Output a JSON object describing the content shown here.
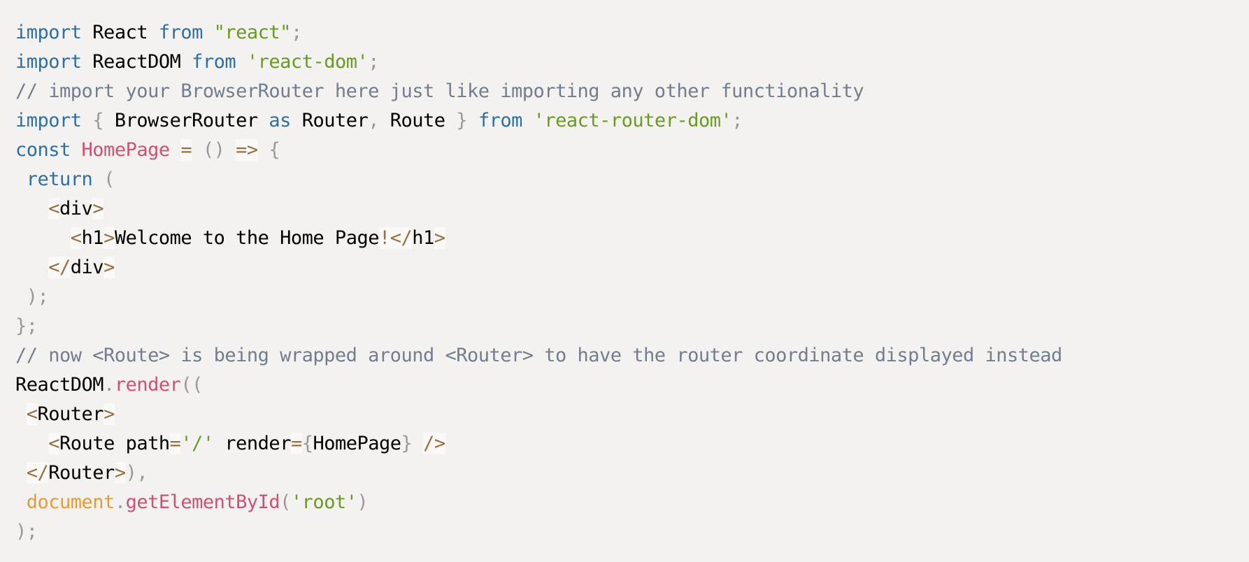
{
  "code": {
    "language": "jsx",
    "colors": {
      "background": "#f4f2f0",
      "keyword": "#2d6fa4",
      "string": "#6a9a23",
      "comment": "#727d8e",
      "function": "#d05070",
      "punctuation": "#999999",
      "operator": "#96703f",
      "object": "#e69a35",
      "plain": "#000000"
    },
    "lines": [
      [
        [
          "kw",
          "import"
        ],
        [
          "plain",
          " React "
        ],
        [
          "kw",
          "from"
        ],
        [
          "plain",
          " "
        ],
        [
          "str",
          "\"react\""
        ],
        [
          "punc",
          ";"
        ]
      ],
      [
        [
          "kw",
          "import"
        ],
        [
          "plain",
          " ReactDOM "
        ],
        [
          "kw",
          "from"
        ],
        [
          "plain",
          " "
        ],
        [
          "str",
          "'react-dom'"
        ],
        [
          "punc",
          ";"
        ]
      ],
      [
        [
          "cm",
          "// import your BrowserRouter here just like importing any other functionality"
        ]
      ],
      [
        [
          "kw",
          "import"
        ],
        [
          "plain",
          " "
        ],
        [
          "punc",
          "{"
        ],
        [
          "plain",
          " BrowserRouter "
        ],
        [
          "kw",
          "as"
        ],
        [
          "plain",
          " Router"
        ],
        [
          "punc",
          ","
        ],
        [
          "plain",
          " Route "
        ],
        [
          "punc",
          "}"
        ],
        [
          "plain",
          " "
        ],
        [
          "kw",
          "from"
        ],
        [
          "plain",
          " "
        ],
        [
          "str",
          "'react-router-dom'"
        ],
        [
          "punc",
          ";"
        ]
      ],
      [
        [
          "kw",
          "const"
        ],
        [
          "plain",
          " "
        ],
        [
          "fn",
          "HomePage"
        ],
        [
          "plain",
          " "
        ],
        [
          "op",
          "="
        ],
        [
          "plain",
          " "
        ],
        [
          "punc",
          "()"
        ],
        [
          "plain",
          " "
        ],
        [
          "op",
          "=>"
        ],
        [
          "plain",
          " "
        ],
        [
          "punc",
          "{"
        ]
      ],
      [
        [
          "plain",
          " "
        ],
        [
          "kw",
          "return"
        ],
        [
          "plain",
          " "
        ],
        [
          "punc",
          "("
        ]
      ],
      [
        [
          "plain",
          "   "
        ],
        [
          "op",
          "<"
        ],
        [
          "plain",
          "div"
        ],
        [
          "op",
          ">"
        ]
      ],
      [
        [
          "plain",
          "     "
        ],
        [
          "op",
          "<"
        ],
        [
          "plain",
          "h1"
        ],
        [
          "op",
          ">"
        ],
        [
          "plain",
          "Welcome to the Home Page"
        ],
        [
          "op",
          "!</"
        ],
        [
          "plain",
          "h1"
        ],
        [
          "op",
          ">"
        ]
      ],
      [
        [
          "plain",
          "   "
        ],
        [
          "op",
          "</"
        ],
        [
          "plain",
          "div"
        ],
        [
          "op",
          ">"
        ]
      ],
      [
        [
          "plain",
          " "
        ],
        [
          "punc",
          ");"
        ]
      ],
      [
        [
          "punc",
          "};"
        ]
      ],
      [
        [
          "cm",
          "// now <Route> is being wrapped around <Router> to have the router coordinate displayed instead"
        ]
      ],
      [
        [
          "plain",
          "ReactDOM"
        ],
        [
          "punc",
          "."
        ],
        [
          "fn",
          "render"
        ],
        [
          "punc",
          "(("
        ]
      ],
      [
        [
          "plain",
          " "
        ],
        [
          "op",
          "<"
        ],
        [
          "plain",
          "Router"
        ],
        [
          "op",
          ">"
        ]
      ],
      [
        [
          "plain",
          "   "
        ],
        [
          "op",
          "<"
        ],
        [
          "plain",
          "Route path"
        ],
        [
          "op",
          "="
        ],
        [
          "str",
          "'/'"
        ],
        [
          "plain",
          " render"
        ],
        [
          "op",
          "="
        ],
        [
          "punc",
          "{"
        ],
        [
          "plain",
          "HomePage"
        ],
        [
          "punc",
          "}"
        ],
        [
          "plain",
          " "
        ],
        [
          "op",
          "/>"
        ]
      ],
      [
        [
          "plain",
          " "
        ],
        [
          "op",
          "</"
        ],
        [
          "plain",
          "Router"
        ],
        [
          "op",
          ">"
        ],
        [
          "punc",
          "),"
        ]
      ],
      [
        [
          "plain",
          " "
        ],
        [
          "obj",
          "document"
        ],
        [
          "punc",
          "."
        ],
        [
          "fn",
          "getElementById"
        ],
        [
          "punc",
          "("
        ],
        [
          "str",
          "'root'"
        ],
        [
          "punc",
          ")"
        ]
      ],
      [
        [
          "punc",
          ");"
        ]
      ]
    ]
  }
}
